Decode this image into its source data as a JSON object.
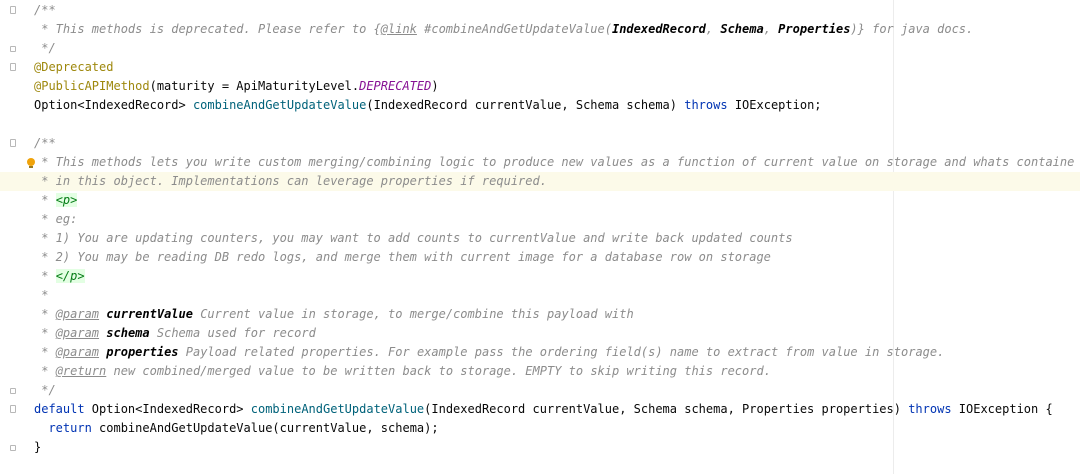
{
  "editor": {
    "lines": [
      {
        "id": "l01",
        "fold": "start",
        "tokens": [
          {
            "t": "/**",
            "c": "cm"
          }
        ]
      },
      {
        "id": "l02",
        "tokens": [
          {
            "t": " * This methods is deprecated. Please refer to {",
            "c": "cm"
          },
          {
            "t": "@link",
            "c": "tag"
          },
          {
            "t": " #combineAndGetUpdateValue(",
            "c": "cm"
          },
          {
            "t": "IndexedRecord",
            "c": "ref"
          },
          {
            "t": ", ",
            "c": "cm"
          },
          {
            "t": "Schema",
            "c": "ref"
          },
          {
            "t": ", ",
            "c": "cm"
          },
          {
            "t": "Properties",
            "c": "ref"
          },
          {
            "t": ")} for java docs.",
            "c": "cm"
          }
        ]
      },
      {
        "id": "l03",
        "fold": "end",
        "tokens": [
          {
            "t": " */",
            "c": "cm"
          }
        ]
      },
      {
        "id": "l04",
        "fold": "start",
        "tokens": [
          {
            "t": "@Deprecated",
            "c": "ann"
          }
        ]
      },
      {
        "id": "l05",
        "tokens": [
          {
            "t": "@PublicAPIMethod",
            "c": "ann"
          },
          {
            "t": "(maturity = ApiMaturityLevel.",
            "c": ""
          },
          {
            "t": "DEPRECATED",
            "c": "cst"
          },
          {
            "t": ")",
            "c": ""
          }
        ]
      },
      {
        "id": "l06",
        "tokens": [
          {
            "t": "Option<IndexedRecord> ",
            "c": ""
          },
          {
            "t": "combineAndGetUpdateValue",
            "c": "fn"
          },
          {
            "t": "(IndexedRecord currentValue, Schema schema) ",
            "c": ""
          },
          {
            "t": "throws",
            "c": "kw"
          },
          {
            "t": " IOException;",
            "c": ""
          }
        ]
      },
      {
        "id": "l07",
        "tokens": []
      },
      {
        "id": "l08",
        "fold": "start",
        "tokens": [
          {
            "t": "/**",
            "c": "cm"
          }
        ]
      },
      {
        "id": "l09",
        "bulb": true,
        "tokens": [
          {
            "t": " * This methods lets you write custom merging/combining logic to produce new values as a function of current value on storage and whats containe",
            "c": "cm"
          }
        ]
      },
      {
        "id": "l10",
        "highlight": true,
        "tokens": [
          {
            "t": " * in this object. Implementations can leverage properties if required.",
            "c": "cm"
          }
        ]
      },
      {
        "id": "l11",
        "tokens": [
          {
            "t": " * ",
            "c": "cm"
          },
          {
            "t": "<p>",
            "c": "ht"
          }
        ]
      },
      {
        "id": "l12",
        "tokens": [
          {
            "t": " * eg:",
            "c": "cm"
          }
        ]
      },
      {
        "id": "l13",
        "tokens": [
          {
            "t": " * 1) You are updating counters, you may want to add counts to currentValue and write back updated counts",
            "c": "cm"
          }
        ]
      },
      {
        "id": "l14",
        "tokens": [
          {
            "t": " * 2) You may be reading DB redo logs, and merge them with current image for a database row on storage",
            "c": "cm"
          }
        ]
      },
      {
        "id": "l15",
        "tokens": [
          {
            "t": " * ",
            "c": "cm"
          },
          {
            "t": "</p>",
            "c": "ht"
          }
        ]
      },
      {
        "id": "l16",
        "tokens": [
          {
            "t": " *",
            "c": "cm"
          }
        ]
      },
      {
        "id": "l17",
        "tokens": [
          {
            "t": " * ",
            "c": "cm"
          },
          {
            "t": "@param",
            "c": "tag"
          },
          {
            "t": " ",
            "c": "cm"
          },
          {
            "t": "currentValue",
            "c": "pn"
          },
          {
            "t": " Current value in storage, to merge/combine this payload with",
            "c": "cm"
          }
        ]
      },
      {
        "id": "l18",
        "tokens": [
          {
            "t": " * ",
            "c": "cm"
          },
          {
            "t": "@param",
            "c": "tag"
          },
          {
            "t": " ",
            "c": "cm"
          },
          {
            "t": "schema",
            "c": "pn"
          },
          {
            "t": " Schema used for record",
            "c": "cm"
          }
        ]
      },
      {
        "id": "l19",
        "tokens": [
          {
            "t": " * ",
            "c": "cm"
          },
          {
            "t": "@param",
            "c": "tag"
          },
          {
            "t": " ",
            "c": "cm"
          },
          {
            "t": "properties",
            "c": "pn"
          },
          {
            "t": " Payload related properties. For example pass the ordering field(s) name to extract from value in storage.",
            "c": "cm"
          }
        ]
      },
      {
        "id": "l20",
        "tokens": [
          {
            "t": " * ",
            "c": "cm"
          },
          {
            "t": "@return",
            "c": "tag"
          },
          {
            "t": " new combined/merged value to be written back to storage. EMPTY to skip writing this record.",
            "c": "cm"
          }
        ]
      },
      {
        "id": "l21",
        "fold": "end",
        "tokens": [
          {
            "t": " */",
            "c": "cm"
          }
        ]
      },
      {
        "id": "l22",
        "fold": "start",
        "tokens": [
          {
            "t": "default",
            "c": "kw"
          },
          {
            "t": " Option<IndexedRecord> ",
            "c": ""
          },
          {
            "t": "combineAndGetUpdateValue",
            "c": "fn"
          },
          {
            "t": "(IndexedRecord currentValue, Schema schema, Properties properties) ",
            "c": ""
          },
          {
            "t": "throws",
            "c": "kw"
          },
          {
            "t": " IOException {",
            "c": ""
          }
        ]
      },
      {
        "id": "l23",
        "tokens": [
          {
            "t": "  ",
            "c": ""
          },
          {
            "t": "return",
            "c": "kw"
          },
          {
            "t": " combineAndGetUpdateValue(currentValue, schema);",
            "c": ""
          }
        ]
      },
      {
        "id": "l24",
        "fold": "end",
        "tokens": [
          {
            "t": "}",
            "c": ""
          }
        ]
      }
    ]
  }
}
